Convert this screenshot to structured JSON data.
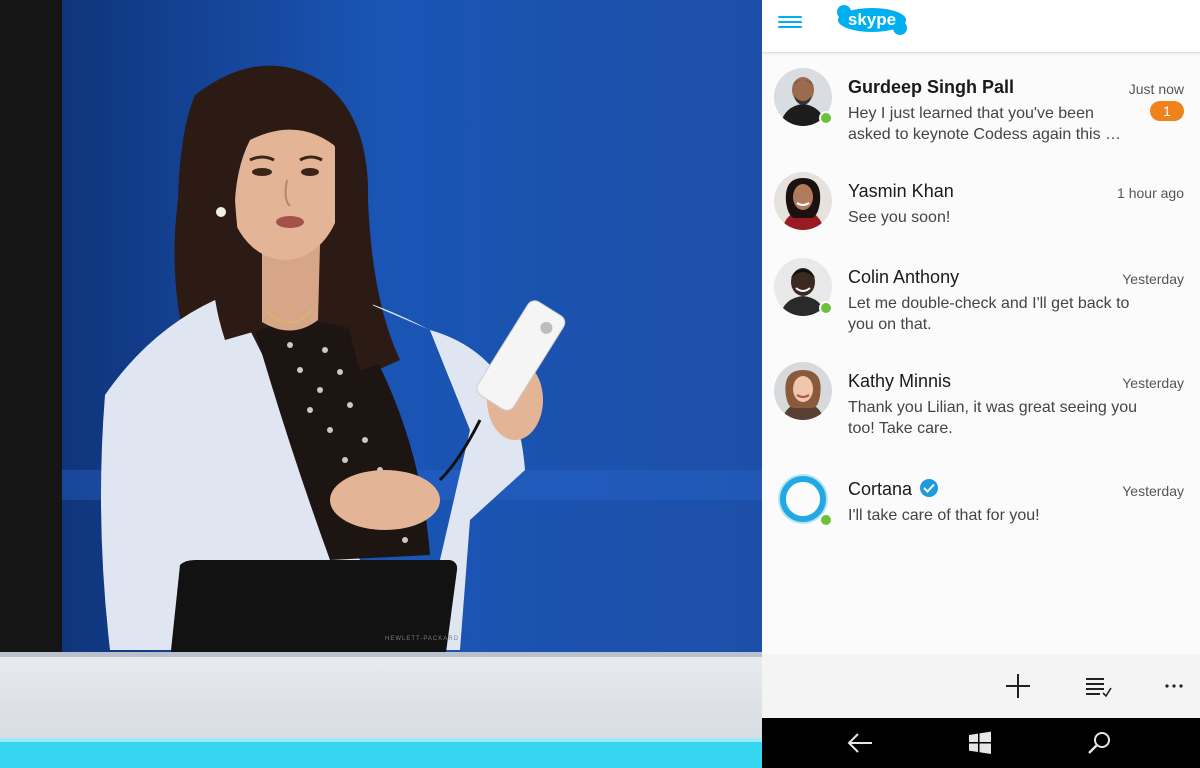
{
  "app": {
    "logo_text": "skype",
    "brand_color": "#00aff0",
    "presence_color": "#6cc13a",
    "badge_color": "#f0821e"
  },
  "header": {
    "menu_icon": "hamburger-menu-icon"
  },
  "conversations": [
    {
      "name": "Gurdeep Singh Pall",
      "time": "Just now",
      "message": "Hey I just learned that you've been asked to keynote Codess again this …",
      "unread": "1",
      "online": true,
      "bold": true
    },
    {
      "name": "Yasmin Khan",
      "time": "1 hour ago",
      "message": "See you soon!",
      "online": false,
      "bold": false
    },
    {
      "name": "Colin Anthony",
      "time": "Yesterday",
      "message": "Let me double-check and I'll get back to you on that.",
      "online": true,
      "bold": false
    },
    {
      "name": "Kathy Minnis",
      "time": "Yesterday",
      "message": "Thank you Lilian, it was great seeing you too! Take care.",
      "online": false,
      "bold": false
    },
    {
      "name": "Cortana",
      "time": "Yesterday",
      "message": "I'll take care of that for you!",
      "online": true,
      "verified": true,
      "bold": false
    }
  ],
  "app_bar": {
    "icons": [
      "add-icon",
      "select-list-icon",
      "more-icon"
    ]
  },
  "nav_bar": {
    "icons": [
      "back-icon",
      "windows-start-icon",
      "search-icon"
    ]
  },
  "stage": {
    "laptop_brand": "HEWLETT-PACKARD"
  }
}
